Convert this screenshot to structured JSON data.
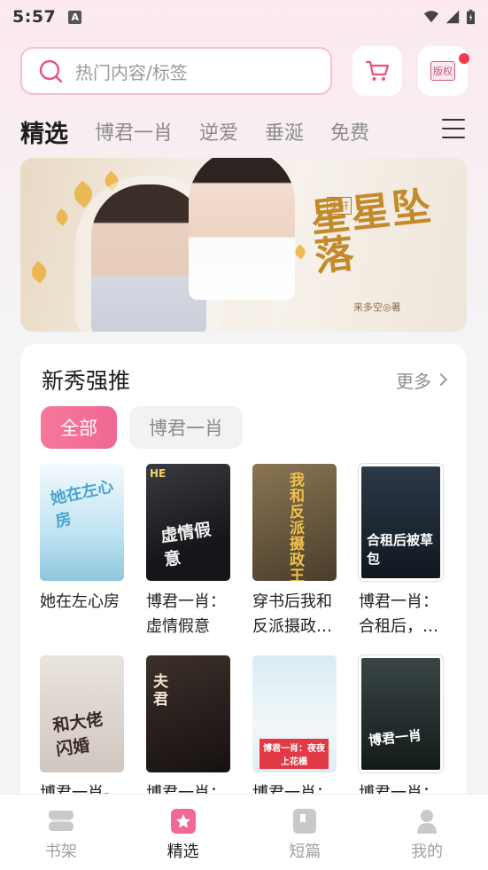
{
  "status_bar": {
    "time": "5:57",
    "notif_icon": "A"
  },
  "search": {
    "placeholder": "热门内容/标签",
    "icon": "search-icon"
  },
  "header_buttons": {
    "cart_icon": "cart-icon",
    "copyright_label": "版权",
    "copyright_badge_color": "#f23b4e"
  },
  "tabs": [
    {
      "label": "精选",
      "active": true
    },
    {
      "label": "博君一肖",
      "active": false
    },
    {
      "label": "逆爱",
      "active": false
    },
    {
      "label": "垂涎",
      "active": false
    },
    {
      "label": "免费",
      "active": false
    }
  ],
  "banner": {
    "title_art": "星星坠落",
    "tag": "文轩",
    "author": "来多空◎著"
  },
  "section": {
    "title": "新秀强推",
    "more_label": "更多",
    "filters": [
      {
        "label": "全部",
        "active": true
      },
      {
        "label": "博君一肖",
        "active": false
      }
    ],
    "books": [
      {
        "title": "她在左心房",
        "cover_text": "她在左心房",
        "cover_colors": [
          "#eaf6fb",
          "#9fd3ec"
        ]
      },
      {
        "title": "博君一肖：虚情假意",
        "cover_text": "虚情假意",
        "cover_colors": [
          "#2a2a2e",
          "#0f0f12"
        ]
      },
      {
        "title": "穿书后我和反派摄政…",
        "cover_text": "我和反派摄政王",
        "cover_colors": [
          "#6b5a3e",
          "#3d3326"
        ]
      },
      {
        "title": "博君一肖：合租后，…",
        "cover_text": "合租后被草包",
        "cover_colors": [
          "#1f2a36",
          "#0e151d"
        ]
      },
      {
        "title": "博君一肖-",
        "cover_text": "和大佬闪婚",
        "cover_colors": [
          "#d9d2cc",
          "#b8aea6"
        ]
      },
      {
        "title": "博君一肖：",
        "cover_text": "夫君",
        "cover_colors": [
          "#2c2320",
          "#141010"
        ]
      },
      {
        "title": "博君一肖：",
        "cover_text": "博君一肖：夜夜上花榻",
        "cover_colors": [
          "#c8e2ee",
          "#e8f2f6"
        ]
      },
      {
        "title": "博君一肖：",
        "cover_text": "博君一肖",
        "cover_colors": [
          "#2f3838",
          "#151b1b"
        ]
      }
    ]
  },
  "bottom_nav": [
    {
      "label": "书架",
      "icon": "bookshelf-icon",
      "active": false
    },
    {
      "label": "精选",
      "icon": "featured-star-icon",
      "active": true
    },
    {
      "label": "短篇",
      "icon": "short-story-icon",
      "active": false
    },
    {
      "label": "我的",
      "icon": "profile-icon",
      "active": false
    }
  ],
  "colors": {
    "accent": "#f06894",
    "text_primary": "#1e1e1e",
    "text_muted": "#8c8c8c"
  }
}
